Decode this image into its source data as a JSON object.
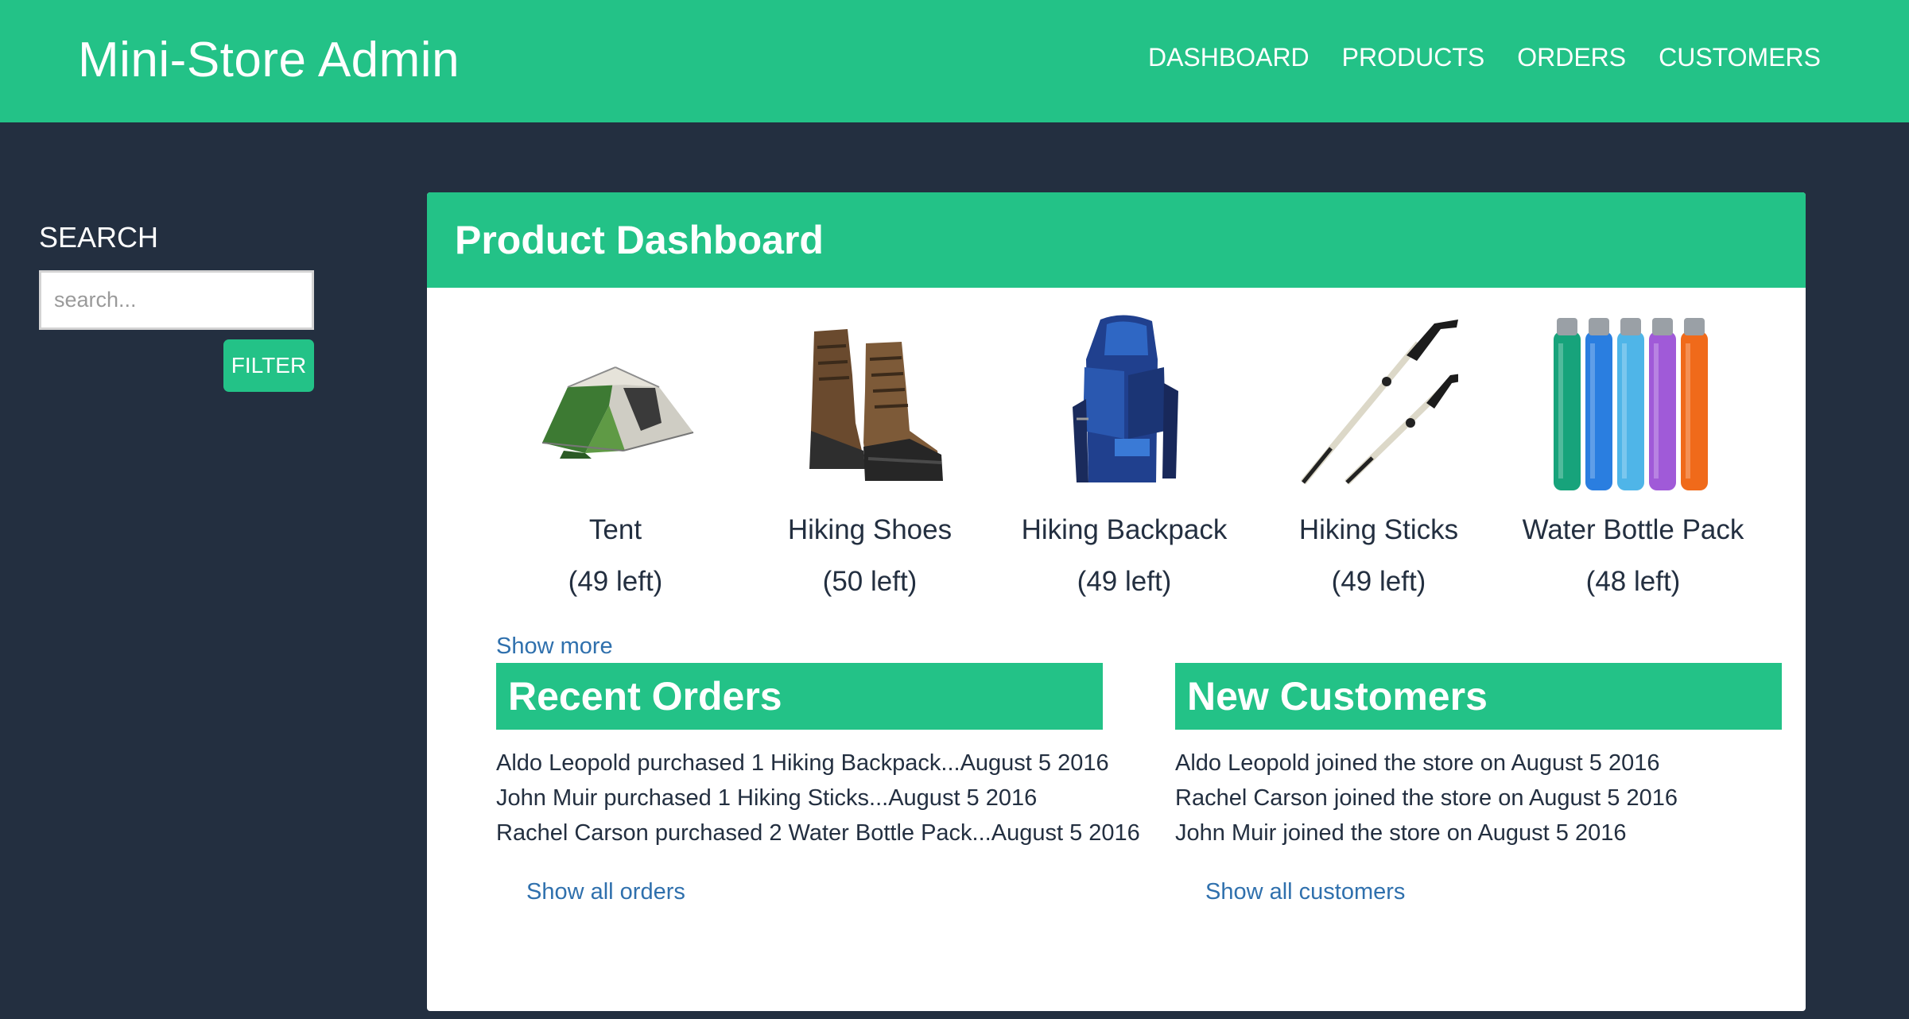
{
  "header": {
    "brand": "Mini-Store Admin",
    "nav": [
      {
        "label": "DASHBOARD"
      },
      {
        "label": "PRODUCTS"
      },
      {
        "label": "ORDERS"
      },
      {
        "label": "CUSTOMERS"
      }
    ]
  },
  "sidebar": {
    "search_title": "SEARCH",
    "search_placeholder": "search...",
    "filter_label": "FILTER"
  },
  "dashboard": {
    "title": "Product Dashboard",
    "products": [
      {
        "name": "Tent",
        "stock": "(49 left)",
        "icon": "tent-image"
      },
      {
        "name": "Hiking Shoes",
        "stock": "(50 left)",
        "icon": "hiking-shoes-image"
      },
      {
        "name": "Hiking Backpack",
        "stock": "(49 left)",
        "icon": "hiking-backpack-image"
      },
      {
        "name": "Hiking Sticks",
        "stock": "(49 left)",
        "icon": "hiking-sticks-image"
      },
      {
        "name": "Water Bottle Pack",
        "stock": "(48 left)",
        "icon": "water-bottle-pack-image"
      }
    ],
    "show_more": "Show more",
    "recent_orders": {
      "title": "Recent Orders",
      "items": [
        "Aldo Leopold purchased 1 Hiking Backpack...August 5 2016",
        "John Muir purchased 1 Hiking Sticks...August 5 2016",
        "Rachel Carson purchased 2 Water Bottle Pack...August 5 2016"
      ],
      "link": "Show all orders"
    },
    "new_customers": {
      "title": "New Customers",
      "items": [
        "Aldo Leopold joined the store on August 5 2016",
        "Rachel Carson joined the store on August 5 2016",
        "John Muir joined the store on August 5 2016"
      ],
      "link": "Show all customers"
    }
  },
  "colors": {
    "accent": "#23c287",
    "background": "#232f40",
    "link": "#2f70ad"
  }
}
